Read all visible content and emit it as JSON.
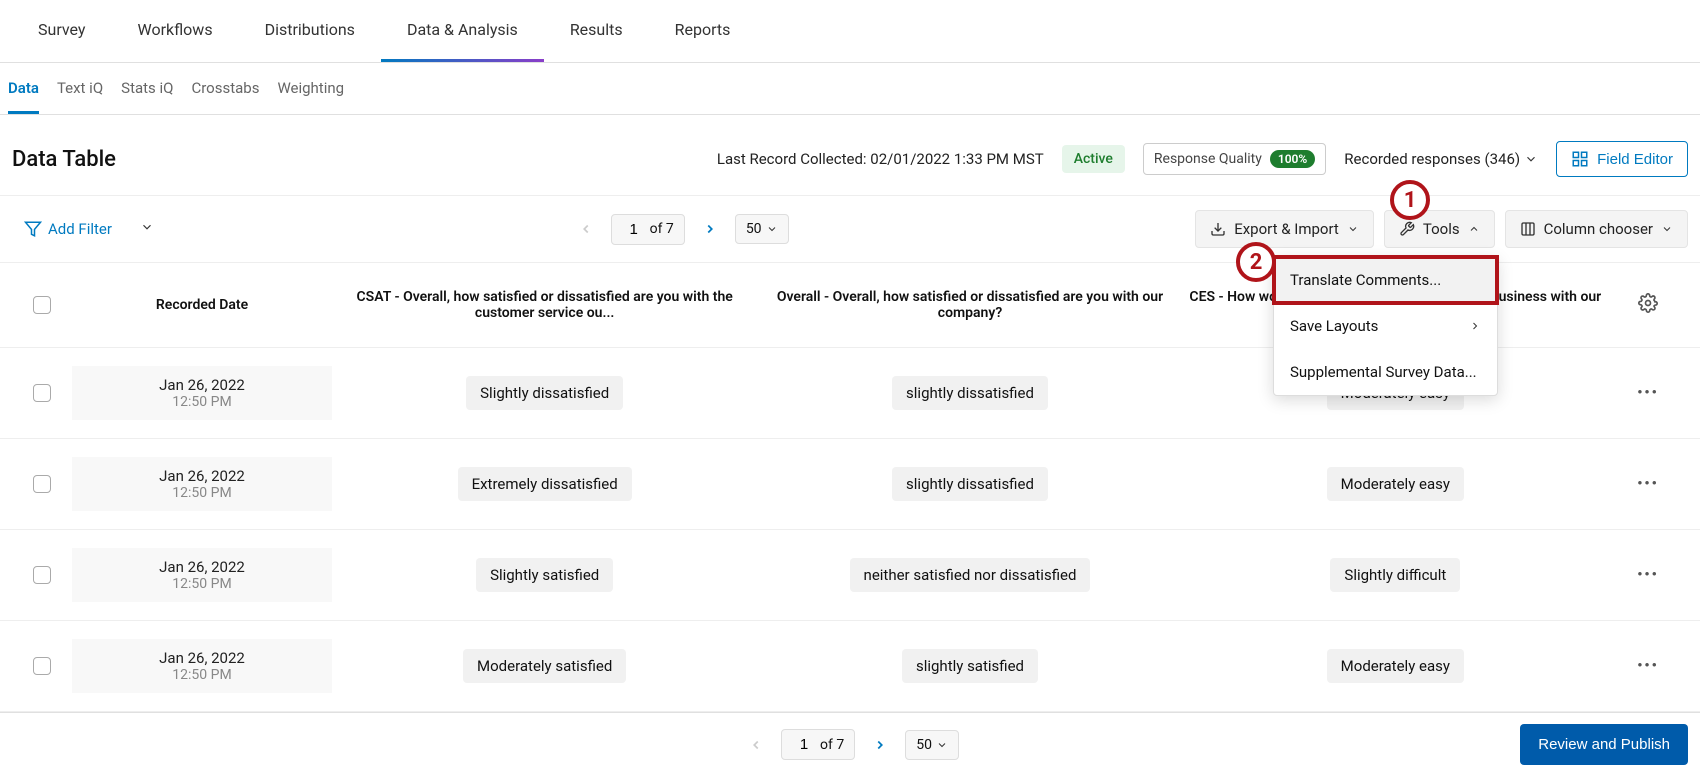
{
  "topNav": [
    {
      "label": "Survey"
    },
    {
      "label": "Workflows"
    },
    {
      "label": "Distributions"
    },
    {
      "label": "Data & Analysis",
      "active": true
    },
    {
      "label": "Results"
    },
    {
      "label": "Reports"
    }
  ],
  "subNav": [
    {
      "label": "Data",
      "active": true
    },
    {
      "label": "Text iQ"
    },
    {
      "label": "Stats iQ"
    },
    {
      "label": "Crosstabs"
    },
    {
      "label": "Weighting"
    }
  ],
  "header": {
    "title": "Data Table",
    "lastRecord": "Last Record Collected: 02/01/2022 1:33 PM MST",
    "activeLabel": "Active",
    "respQuality": "Response Quality",
    "respPct": "100%",
    "recorded": "Recorded responses (346)",
    "fieldEditor": "Field Editor"
  },
  "toolbar": {
    "addFilter": "Add Filter",
    "page": "1",
    "ofPages": "of 7",
    "pageSize": "50",
    "exportImport": "Export & Import",
    "tools": "Tools",
    "columnChooser": "Column chooser"
  },
  "dropdown": {
    "translate": "Translate Comments...",
    "saveLayouts": "Save Layouts",
    "supplemental": "Supplemental Survey Data..."
  },
  "columns": {
    "recordedDate": "Recorded Date",
    "csat": "CSAT - Overall, how satisfied or dissatisfied are you with the customer service ou...",
    "overall": "Overall - Overall, how satisfied or dissatisfied are you with our company?",
    "ces": "CES - How would you rate the difficulty of doing business with our co..."
  },
  "rows": [
    {
      "date": "Jan 26, 2022",
      "time": "12:50 PM",
      "csat": "Slightly dissatisfied",
      "overall": "slightly dissatisfied",
      "ces": "Moderately easy"
    },
    {
      "date": "Jan 26, 2022",
      "time": "12:50 PM",
      "csat": "Extremely dissatisfied",
      "overall": "slightly dissatisfied",
      "ces": "Moderately easy"
    },
    {
      "date": "Jan 26, 2022",
      "time": "12:50 PM",
      "csat": "Slightly satisfied",
      "overall": "neither satisfied nor dissatisfied",
      "ces": "Slightly difficult"
    },
    {
      "date": "Jan 26, 2022",
      "time": "12:50 PM",
      "csat": "Moderately satisfied",
      "overall": "slightly satisfied",
      "ces": "Moderately easy"
    }
  ],
  "footer": {
    "page": "1",
    "ofPages": "of 7",
    "pageSize": "50",
    "publish": "Review and Publish"
  },
  "annotations": {
    "one": "1",
    "two": "2"
  }
}
